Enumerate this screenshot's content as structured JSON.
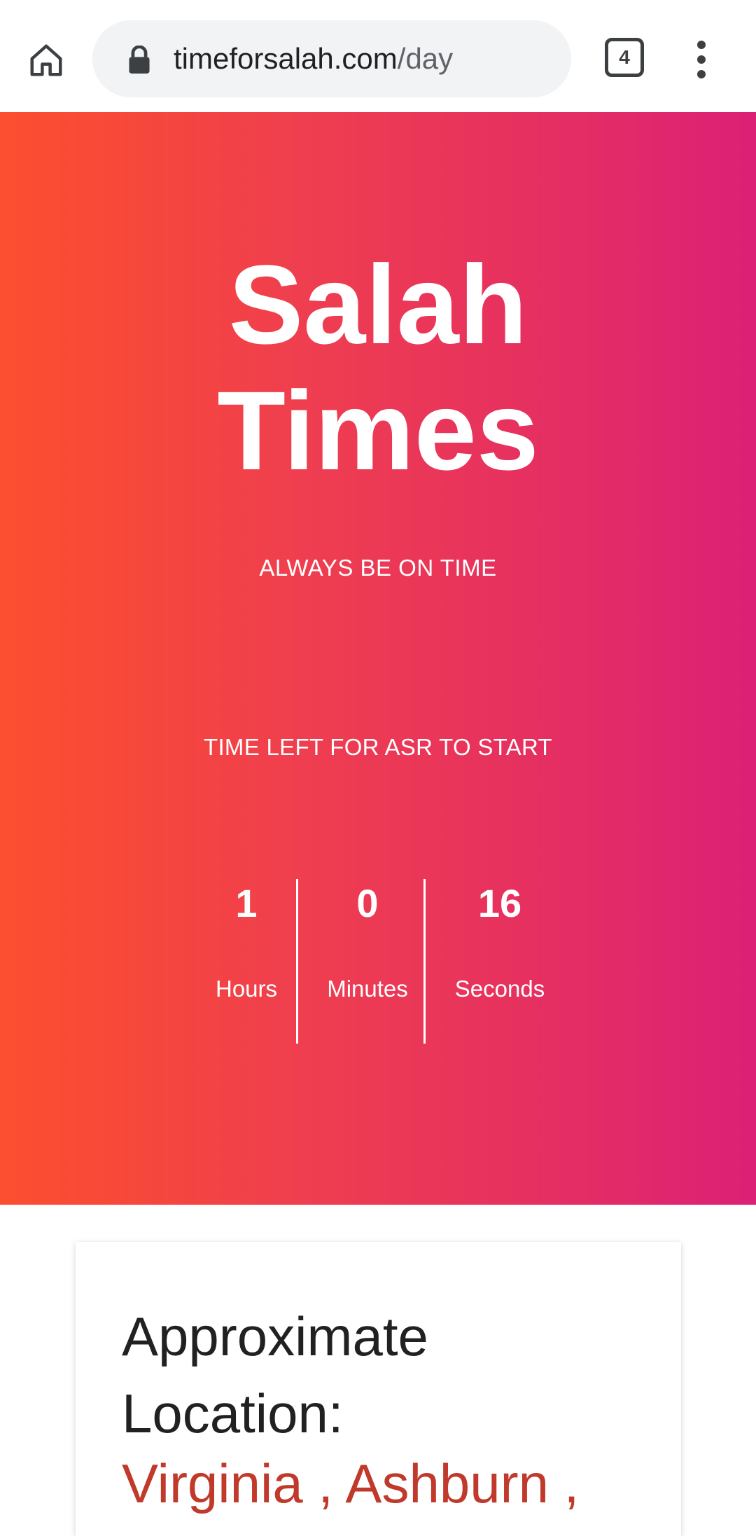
{
  "browser": {
    "url_host": "timeforsalah.com",
    "url_path": "/day",
    "tab_count": "4",
    "icons": {
      "home": "home-icon",
      "lock": "lock-icon",
      "menu": "more-vert-icon"
    }
  },
  "hero": {
    "title_line1": "Salah",
    "title_line2": "Times",
    "tagline": "ALWAYS BE ON TIME",
    "countdown_label": "TIME LEFT FOR ASR TO START",
    "countdown": {
      "hours_value": "1",
      "hours_label": "Hours",
      "minutes_value": "0",
      "minutes_label": "Minutes",
      "seconds_value": "16",
      "seconds_label": "Seconds"
    },
    "gradient_colors": [
      "#fc4e30",
      "#dc2076"
    ]
  },
  "location_card": {
    "heading_line1": "Approximate",
    "heading_line2": "Location:",
    "location": "Virginia , Ashburn ,",
    "location_color": "#c0392b"
  }
}
